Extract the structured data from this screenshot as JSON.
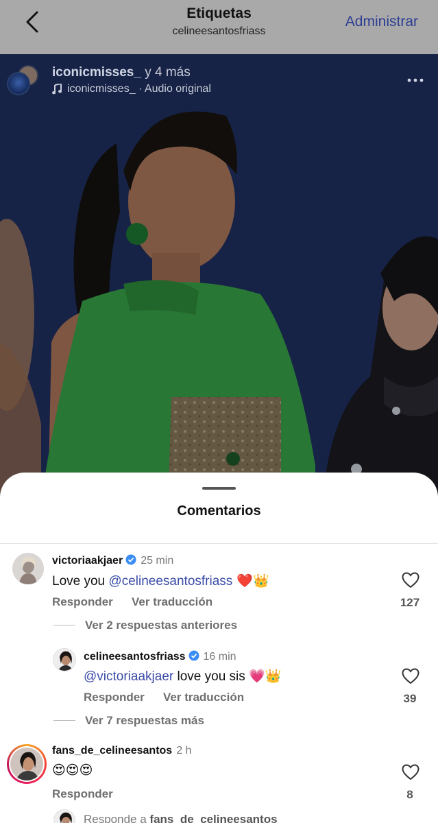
{
  "header": {
    "title": "Etiquetas",
    "subtitle": "celineesantosfriass",
    "manage_label": "Administrar"
  },
  "post": {
    "username": "iconicmisses_",
    "others": "y 4 más",
    "audio": "iconicmisses_ · Audio original"
  },
  "comments_sheet": {
    "title": "Comentarios",
    "comments": [
      {
        "username": "victoriaakjaer",
        "time": "25 min",
        "text_prefix": "Love you ",
        "mention": "@celineesantosfriass",
        "emojis": "❤️👑",
        "reply_label": "Responder",
        "translate_label": "Ver traducción",
        "likes": "127"
      },
      {
        "username": "celineesantosfriass",
        "time": "16 min",
        "mention": "@victoriaakjaer",
        "text_suffix": " love you sis ",
        "emojis": "💗👑",
        "reply_label": "Responder",
        "translate_label": "Ver traducción",
        "likes": "39"
      },
      {
        "username": "fans_de_celineesantos",
        "time": "2 h",
        "emojis": "😍😍😍",
        "reply_label": "Responder",
        "likes": "8"
      }
    ],
    "previous_replies_label": "Ver 2 respuestas anteriores",
    "more_replies_label": "Ver 7 respuestas más",
    "reply_prompt_prefix": "Responde a ",
    "reply_prompt_user": "fans_de_celineesantos"
  },
  "colors": {
    "header_bg": "#a9a9a9",
    "link": "#2d3e93",
    "mention": "#3b4ca8",
    "heart_red": "#e0243a",
    "dress_green": "#3aa64a"
  },
  "icons": [
    "chevron-left-icon",
    "music-note-icon",
    "more-dots-icon",
    "verified-badge-icon",
    "heart-outline-icon"
  ]
}
